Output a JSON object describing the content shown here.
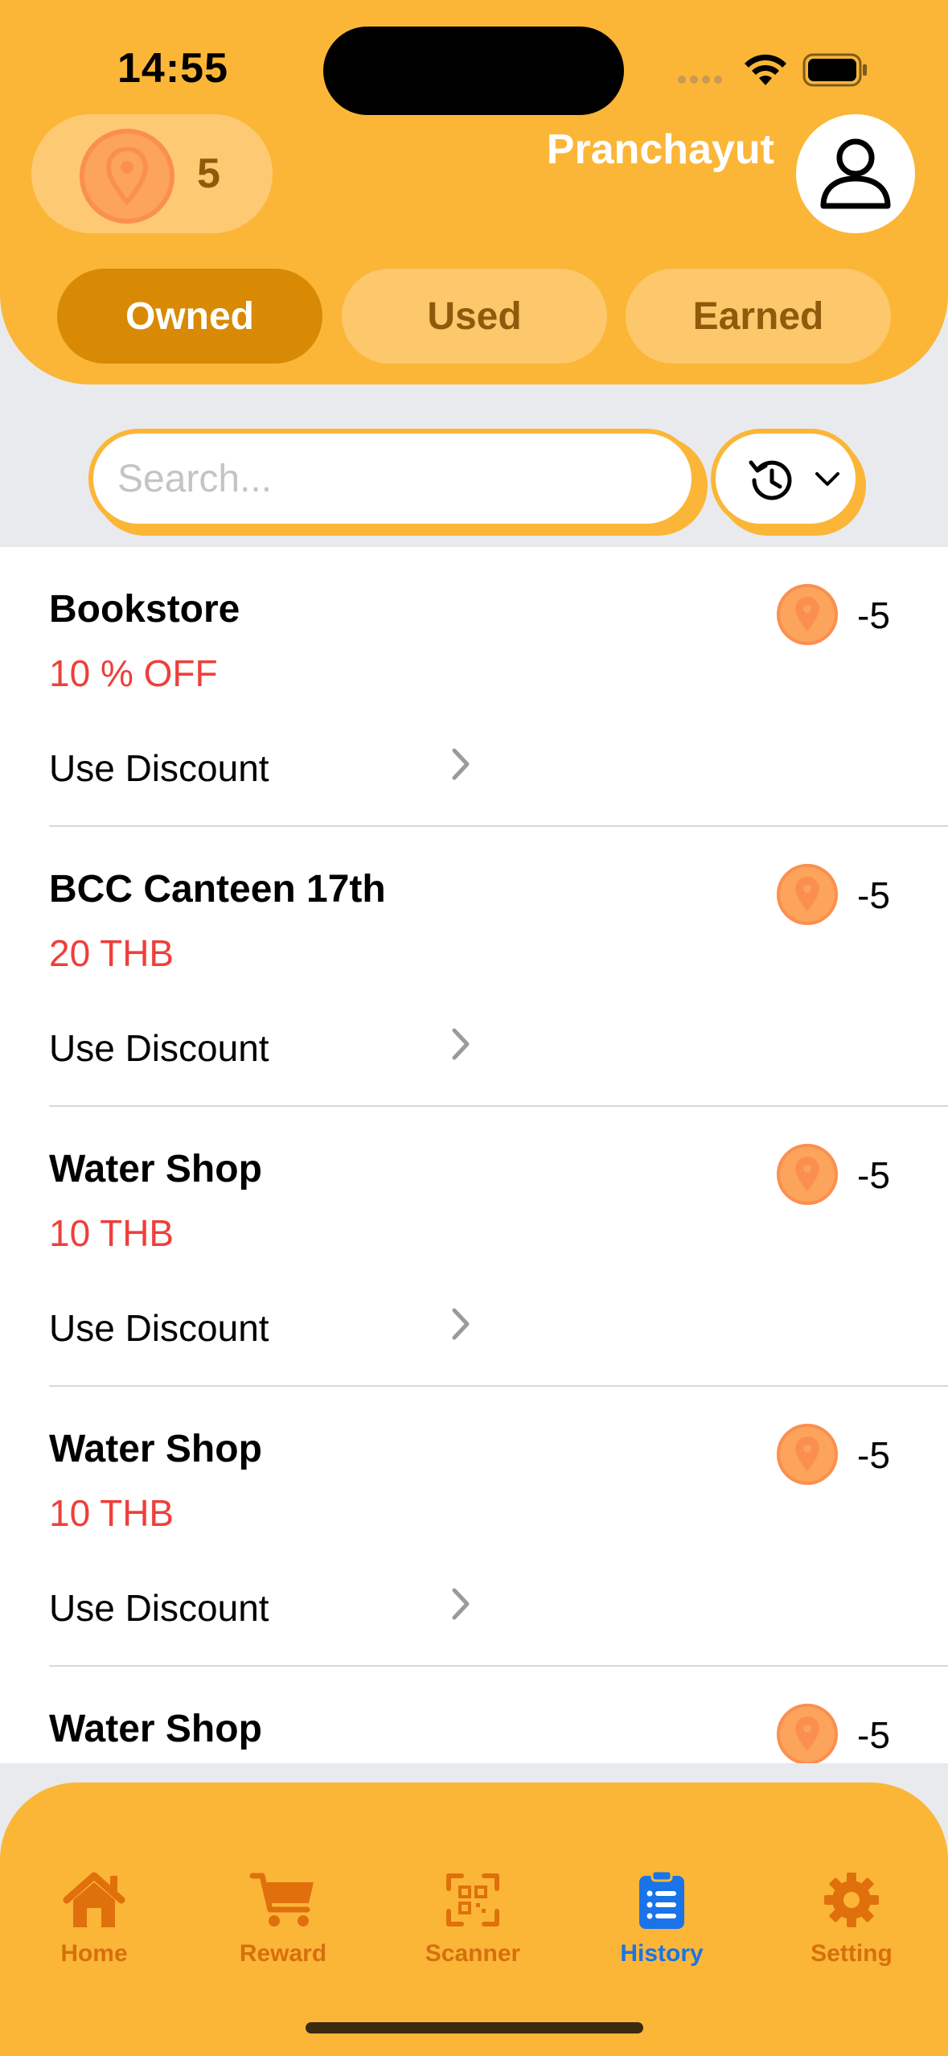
{
  "status_bar": {
    "time": "14:55"
  },
  "header": {
    "points": "5",
    "username": "Pranchayut",
    "segments": [
      {
        "label": "Owned",
        "active": true
      },
      {
        "label": "Used",
        "active": false
      },
      {
        "label": "Earned",
        "active": false
      }
    ]
  },
  "search": {
    "placeholder": "Search...",
    "value": ""
  },
  "items": [
    {
      "title": "Bookstore",
      "discount": "10 % OFF",
      "action": "Use Discount",
      "cost": "-5"
    },
    {
      "title": "BCC Canteen 17th",
      "discount": "20 THB",
      "action": "Use Discount",
      "cost": "-5"
    },
    {
      "title": "Water Shop",
      "discount": "10 THB",
      "action": "Use Discount",
      "cost": "-5"
    },
    {
      "title": "Water Shop",
      "discount": "10 THB",
      "action": "Use Discount",
      "cost": "-5"
    },
    {
      "title": "Water Shop",
      "discount": "",
      "action": "",
      "cost": "-5"
    }
  ],
  "tabbar": {
    "tabs": [
      {
        "label": "Home",
        "icon": "house-icon",
        "active": false
      },
      {
        "label": "Reward",
        "icon": "cart-icon",
        "active": false
      },
      {
        "label": "Scanner",
        "icon": "qr-scan-icon",
        "active": false
      },
      {
        "label": "History",
        "icon": "clipboard-list-icon",
        "active": true
      },
      {
        "label": "Setting",
        "icon": "gear-icon",
        "active": false
      }
    ]
  },
  "colors": {
    "brand": "#fbb638",
    "segment_active": "#d88a05",
    "discount_text": "#ef3f3a",
    "tab_active": "#1a73e8",
    "tab_inactive": "#d6700c"
  }
}
